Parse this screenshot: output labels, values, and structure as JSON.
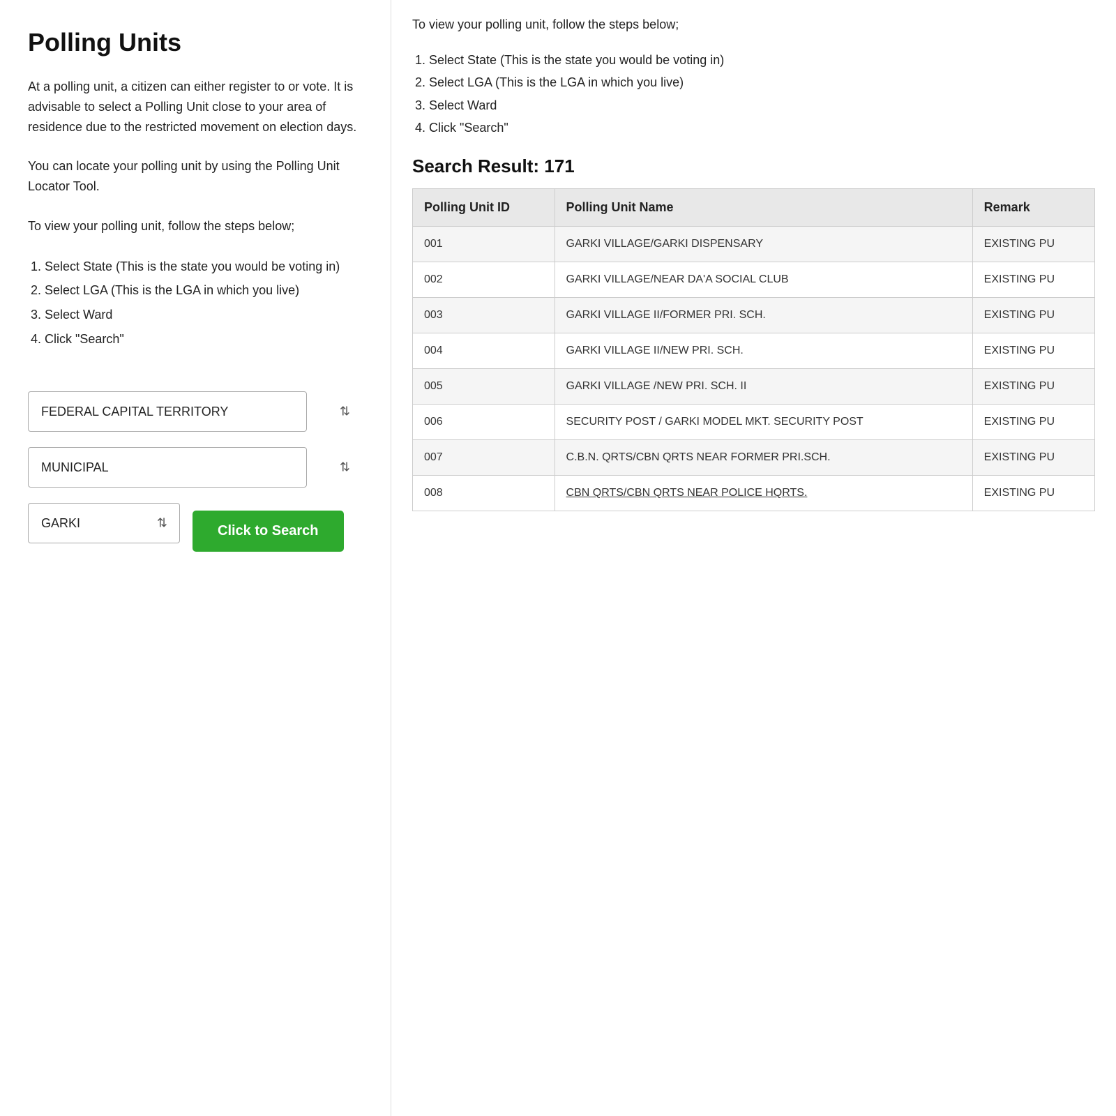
{
  "left": {
    "title": "Polling Units",
    "intro1": "At a polling unit, a citizen can either register to or vote. It is advisable to select a Polling Unit close to your area of residence due to the restricted movement on election days.",
    "intro2": "You can locate your polling unit by using the Polling Unit Locator Tool.",
    "intro3": "To view your polling unit, follow the steps below;",
    "steps": [
      "Select State (This is the state you would be voting in)",
      "Select LGA (This is the LGA in which you live)",
      "Select Ward",
      "Click \"Search\""
    ],
    "state_value": "FEDERAL CAPITAL TERRITORY",
    "lga_value": "MUNICIPAL",
    "ward_value": "GARKI",
    "search_button": "Click to Search"
  },
  "right": {
    "instructions_text": "To view your polling unit, follow the steps below;",
    "steps": [
      "Select State (This is the state you would be voting in)",
      "Select LGA (This is the LGA in which you live)",
      "Select Ward",
      "Click \"Search\""
    ],
    "search_result_label": "Search Result: 171",
    "table_headers": {
      "id": "Polling Unit ID",
      "name": "Polling Unit Name",
      "remark": "Remark"
    },
    "rows": [
      {
        "id": "001",
        "name": "GARKI VILLAGE/GARKI DISPENSARY",
        "remark": "EXISTING PU"
      },
      {
        "id": "002",
        "name": "GARKI VILLAGE/NEAR DA'A SOCIAL CLUB",
        "remark": "EXISTING PU"
      },
      {
        "id": "003",
        "name": "GARKI VILLAGE II/FORMER PRI. SCH.",
        "remark": "EXISTING PU"
      },
      {
        "id": "004",
        "name": "GARKI VILLAGE II/NEW PRI. SCH.",
        "remark": "EXISTING PU"
      },
      {
        "id": "005",
        "name": "GARKI VILLAGE /NEW PRI. SCH. II",
        "remark": "EXISTING PU"
      },
      {
        "id": "006",
        "name": "SECURITY POST / GARKI MODEL MKT. SECURITY POST",
        "remark": "EXISTING PU"
      },
      {
        "id": "007",
        "name": "C.B.N. QRTS/CBN QRTS NEAR FORMER PRI.SCH.",
        "remark": "EXISTING PU"
      },
      {
        "id": "008",
        "name": "CBN QRTS/CBN QRTS NEAR POLICE HQRTS.",
        "remark": "EXISTING PU"
      }
    ]
  }
}
